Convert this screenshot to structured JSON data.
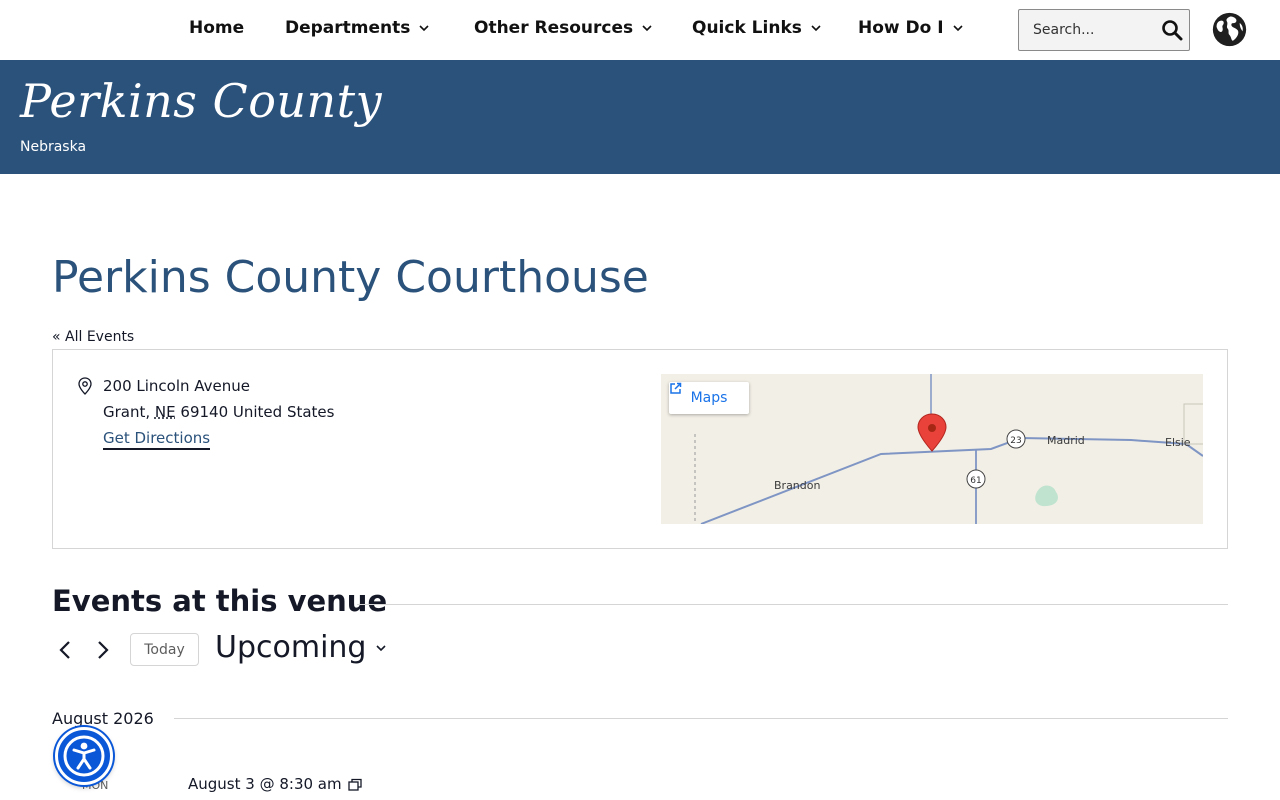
{
  "nav": {
    "items": [
      {
        "label": "Home",
        "has_dropdown": false
      },
      {
        "label": "Departments",
        "has_dropdown": true
      },
      {
        "label": "Other Resources",
        "has_dropdown": true
      },
      {
        "label": "Quick Links",
        "has_dropdown": true
      },
      {
        "label": "How Do I",
        "has_dropdown": true
      }
    ],
    "search_placeholder": "Search...",
    "icons": {
      "search": "search-icon",
      "language": "globe-icon"
    }
  },
  "site": {
    "title": "Perkins County",
    "subtitle": "Nebraska",
    "brand_color": "#2b527b"
  },
  "page": {
    "title": "Perkins County Courthouse",
    "back_link": "« All Events"
  },
  "venue": {
    "street": "200 Lincoln Avenue",
    "city": "Grant,",
    "state_abbr": "NE",
    "zip_country": "69140 United States",
    "directions_label": "Get Directions",
    "map": {
      "button_label": "Maps",
      "labels": [
        "Brandon",
        "Madrid",
        "Elsie"
      ],
      "route_shields": [
        "23",
        "61"
      ]
    }
  },
  "events": {
    "section_title": "Events at this venue",
    "today_label": "Today",
    "view_label": "Upcoming",
    "month": "August 2026",
    "items": [
      {
        "day": "MON",
        "time": "August 3 @ 8:30 am",
        "recurring": true
      }
    ]
  }
}
